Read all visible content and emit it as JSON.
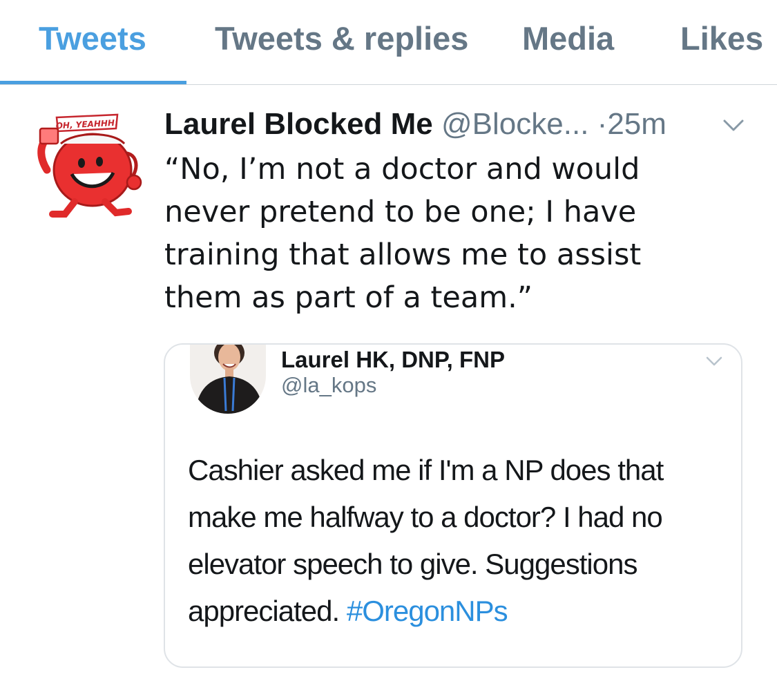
{
  "tabs": [
    {
      "label": "Tweets",
      "active": true
    },
    {
      "label": "Tweets & replies",
      "active": false
    },
    {
      "label": "Media",
      "active": false
    },
    {
      "label": "Likes",
      "active": false
    }
  ],
  "tweet": {
    "author_name": "Laurel Blocked Me",
    "author_handle": "@Blocke...",
    "separator": "·",
    "timestamp": "25m",
    "text": "“No, I’m not a doctor and would never pretend to be one; I have training that allows me to assist them as part of a team.”",
    "avatar_text": "OH, YEAHHH!",
    "avatar_icon": "kool-aid-man-icon",
    "menu_icon": "chevron-down-icon"
  },
  "quoted_tweet": {
    "author_name": "Laurel HK, DNP, FNP",
    "author_handle": "@la_kops",
    "text": "Cashier asked me if I'm a NP does that make me halfway to a doctor? I had no elevator speech to give. Suggestions appreciated.",
    "hashtag": "#OregonNPs",
    "menu_icon": "chevron-down-icon"
  },
  "colors": {
    "accent": "#4a9fe0",
    "secondary_text": "#657786",
    "primary_text": "#14171a",
    "hashtag": "#2b8fde",
    "divider": "#cfd5da"
  }
}
